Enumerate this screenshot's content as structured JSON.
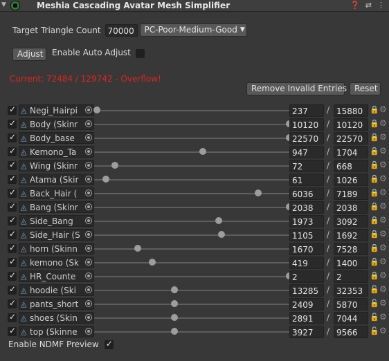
{
  "header": {
    "title": "Meshia Cascading Avatar Mesh Simplifier",
    "help_icon": "help-icon",
    "preset_icon": "preset-icon",
    "menu_icon": "kebab-menu-icon"
  },
  "target": {
    "label": "Target Triangle Count",
    "value": "70000",
    "preset": "PC-Poor-Medium-Good"
  },
  "adjust": {
    "button_label": "Adjust",
    "auto_label": "Enable Auto Adjust",
    "auto_enabled": false
  },
  "status": {
    "text": "Current: 72484 / 129742 - Overflow!",
    "color": "#e0241e"
  },
  "actions": {
    "remove_invalid": "Remove Invalid Entries",
    "reset": "Reset"
  },
  "entries": [
    {
      "name": "Negi_Hairpi",
      "icon": "mesh-filter-icon",
      "value": "237",
      "max": "15880",
      "ratio": 0.015,
      "locked": true
    },
    {
      "name": "Body (Skinr",
      "icon": "skinned-mesh-icon",
      "value": "10120",
      "max": "10120",
      "ratio": 1.0,
      "locked": true
    },
    {
      "name": "Body_base",
      "icon": "skinned-mesh-icon",
      "value": "22570",
      "max": "22570",
      "ratio": 1.0,
      "locked": true
    },
    {
      "name": "Kemono_Ta",
      "icon": "skinned-mesh-icon",
      "value": "947",
      "max": "1704",
      "ratio": 0.556,
      "locked": true
    },
    {
      "name": "Wing (Skinr",
      "icon": "skinned-mesh-icon",
      "value": "72",
      "max": "668",
      "ratio": 0.108,
      "locked": true
    },
    {
      "name": "Atama (Skir",
      "icon": "skinned-mesh-icon",
      "value": "61",
      "max": "1026",
      "ratio": 0.059,
      "locked": true
    },
    {
      "name": "Back_Hair (",
      "icon": "skinned-mesh-icon",
      "value": "6036",
      "max": "7189",
      "ratio": 0.84,
      "locked": true
    },
    {
      "name": "Bang (Skinr",
      "icon": "skinned-mesh-icon",
      "value": "2038",
      "max": "2038",
      "ratio": 1.0,
      "locked": true
    },
    {
      "name": "Side_Bang",
      "icon": "skinned-mesh-icon",
      "value": "1973",
      "max": "3092",
      "ratio": 0.638,
      "locked": true
    },
    {
      "name": "Side_Hair (S",
      "icon": "skinned-mesh-icon",
      "value": "1105",
      "max": "1692",
      "ratio": 0.653,
      "locked": true
    },
    {
      "name": "horn (Skinn",
      "icon": "skinned-mesh-icon",
      "value": "1670",
      "max": "7528",
      "ratio": 0.222,
      "locked": true
    },
    {
      "name": "kemono (Sk",
      "icon": "skinned-mesh-icon",
      "value": "419",
      "max": "1400",
      "ratio": 0.299,
      "locked": true
    },
    {
      "name": "HR_Counte",
      "icon": "mesh-filter-icon",
      "value": "2",
      "max": "2",
      "ratio": 1.0,
      "locked": true
    },
    {
      "name": "hoodie (Ski",
      "icon": "skinned-mesh-icon",
      "value": "13285",
      "max": "32353",
      "ratio": 0.41,
      "locked": false
    },
    {
      "name": "pants_short",
      "icon": "skinned-mesh-icon",
      "value": "2409",
      "max": "5870",
      "ratio": 0.41,
      "locked": false
    },
    {
      "name": "shoes (Skin",
      "icon": "skinned-mesh-icon",
      "value": "2891",
      "max": "7044",
      "ratio": 0.41,
      "locked": false
    },
    {
      "name": "top (Skinne",
      "icon": "skinned-mesh-icon",
      "value": "3927",
      "max": "9566",
      "ratio": 0.41,
      "locked": false
    }
  ],
  "ndmf_preview": {
    "label": "Enable NDMF Preview",
    "enabled": true
  }
}
